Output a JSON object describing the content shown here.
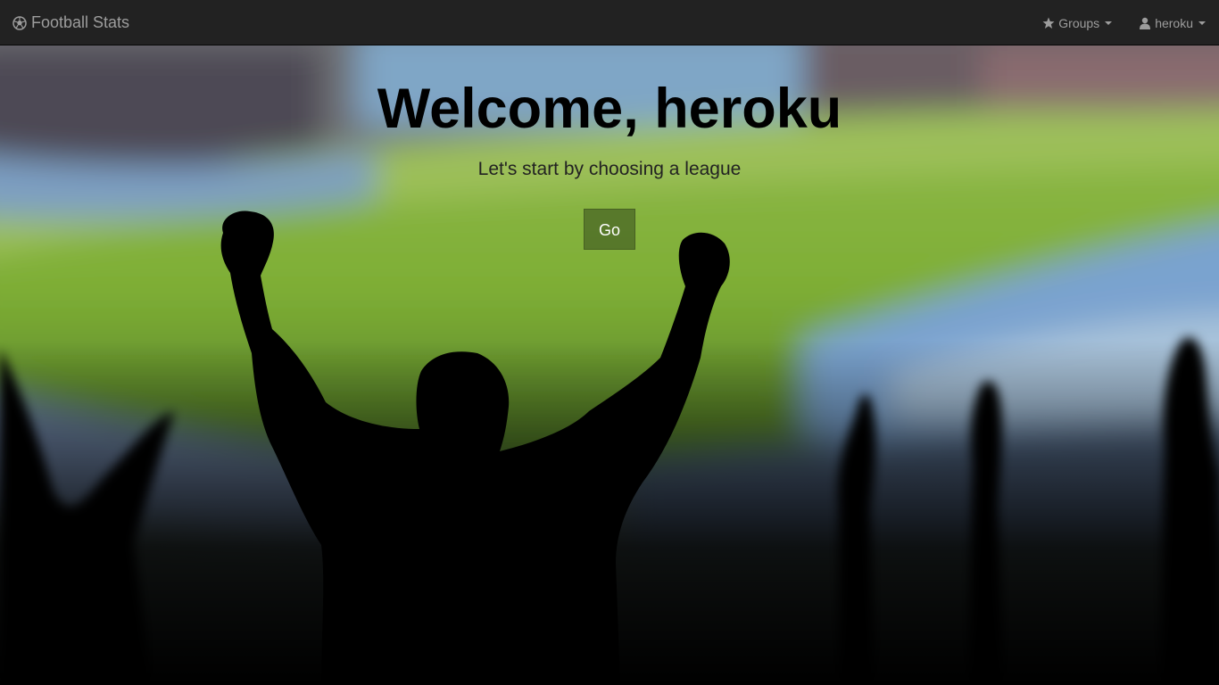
{
  "navbar": {
    "brand_label": "Football Stats",
    "brand_icon": "soccer-ball-icon",
    "groups_label": "Groups",
    "groups_icon": "star-icon",
    "user_label": "heroku",
    "user_icon": "user-icon"
  },
  "hero": {
    "title": "Welcome, heroku",
    "subtitle": "Let's start by choosing a league",
    "go_label": "Go"
  },
  "colors": {
    "navbar_bg": "#222222",
    "navbar_text": "#9d9d9d",
    "go_button_bg": "#5e7a35",
    "pitch_green": "#7fae3a"
  }
}
